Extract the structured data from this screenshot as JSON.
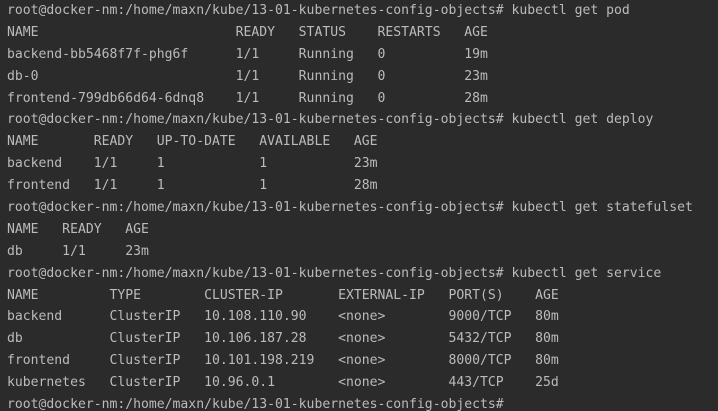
{
  "terminal": {
    "lines": [
      {
        "kind": "command",
        "prompt": "root@docker-nm:/home/maxn/kube/13-01-kubernetes-config-objects#",
        "command": "kubectl get pod"
      },
      {
        "kind": "output",
        "text": "NAME                         READY   STATUS    RESTARTS   AGE"
      },
      {
        "kind": "output",
        "text": "backend-bb5468f7f-phg6f      1/1     Running   0          19m"
      },
      {
        "kind": "output",
        "text": "db-0                         1/1     Running   0          23m"
      },
      {
        "kind": "output",
        "text": "frontend-799db66d64-6dnq8    1/1     Running   0          28m"
      },
      {
        "kind": "command",
        "prompt": "root@docker-nm:/home/maxn/kube/13-01-kubernetes-config-objects#",
        "command": "kubectl get deploy"
      },
      {
        "kind": "output",
        "text": "NAME       READY   UP-TO-DATE   AVAILABLE   AGE"
      },
      {
        "kind": "output",
        "text": "backend    1/1     1            1           23m"
      },
      {
        "kind": "output",
        "text": "frontend   1/1     1            1           28m"
      },
      {
        "kind": "command",
        "prompt": "root@docker-nm:/home/maxn/kube/13-01-kubernetes-config-objects#",
        "command": "kubectl get statefulset"
      },
      {
        "kind": "output",
        "text": "NAME   READY   AGE"
      },
      {
        "kind": "output",
        "text": "db     1/1     23m"
      },
      {
        "kind": "command",
        "prompt": "root@docker-nm:/home/maxn/kube/13-01-kubernetes-config-objects#",
        "command": "kubectl get service"
      },
      {
        "kind": "output",
        "text": "NAME         TYPE        CLUSTER-IP       EXTERNAL-IP   PORT(S)    AGE"
      },
      {
        "kind": "output",
        "text": "backend      ClusterIP   10.108.110.90    <none>        9000/TCP   80m"
      },
      {
        "kind": "output",
        "text": "db           ClusterIP   10.106.187.28    <none>        5432/TCP   80m"
      },
      {
        "kind": "output",
        "text": "frontend     ClusterIP   10.101.198.219   <none>        8000/TCP   80m"
      },
      {
        "kind": "output",
        "text": "kubernetes   ClusterIP   10.96.0.1        <none>        443/TCP    25d"
      },
      {
        "kind": "command",
        "prompt": "root@docker-nm:/home/maxn/kube/13-01-kubernetes-config-objects#",
        "command": ""
      }
    ]
  }
}
